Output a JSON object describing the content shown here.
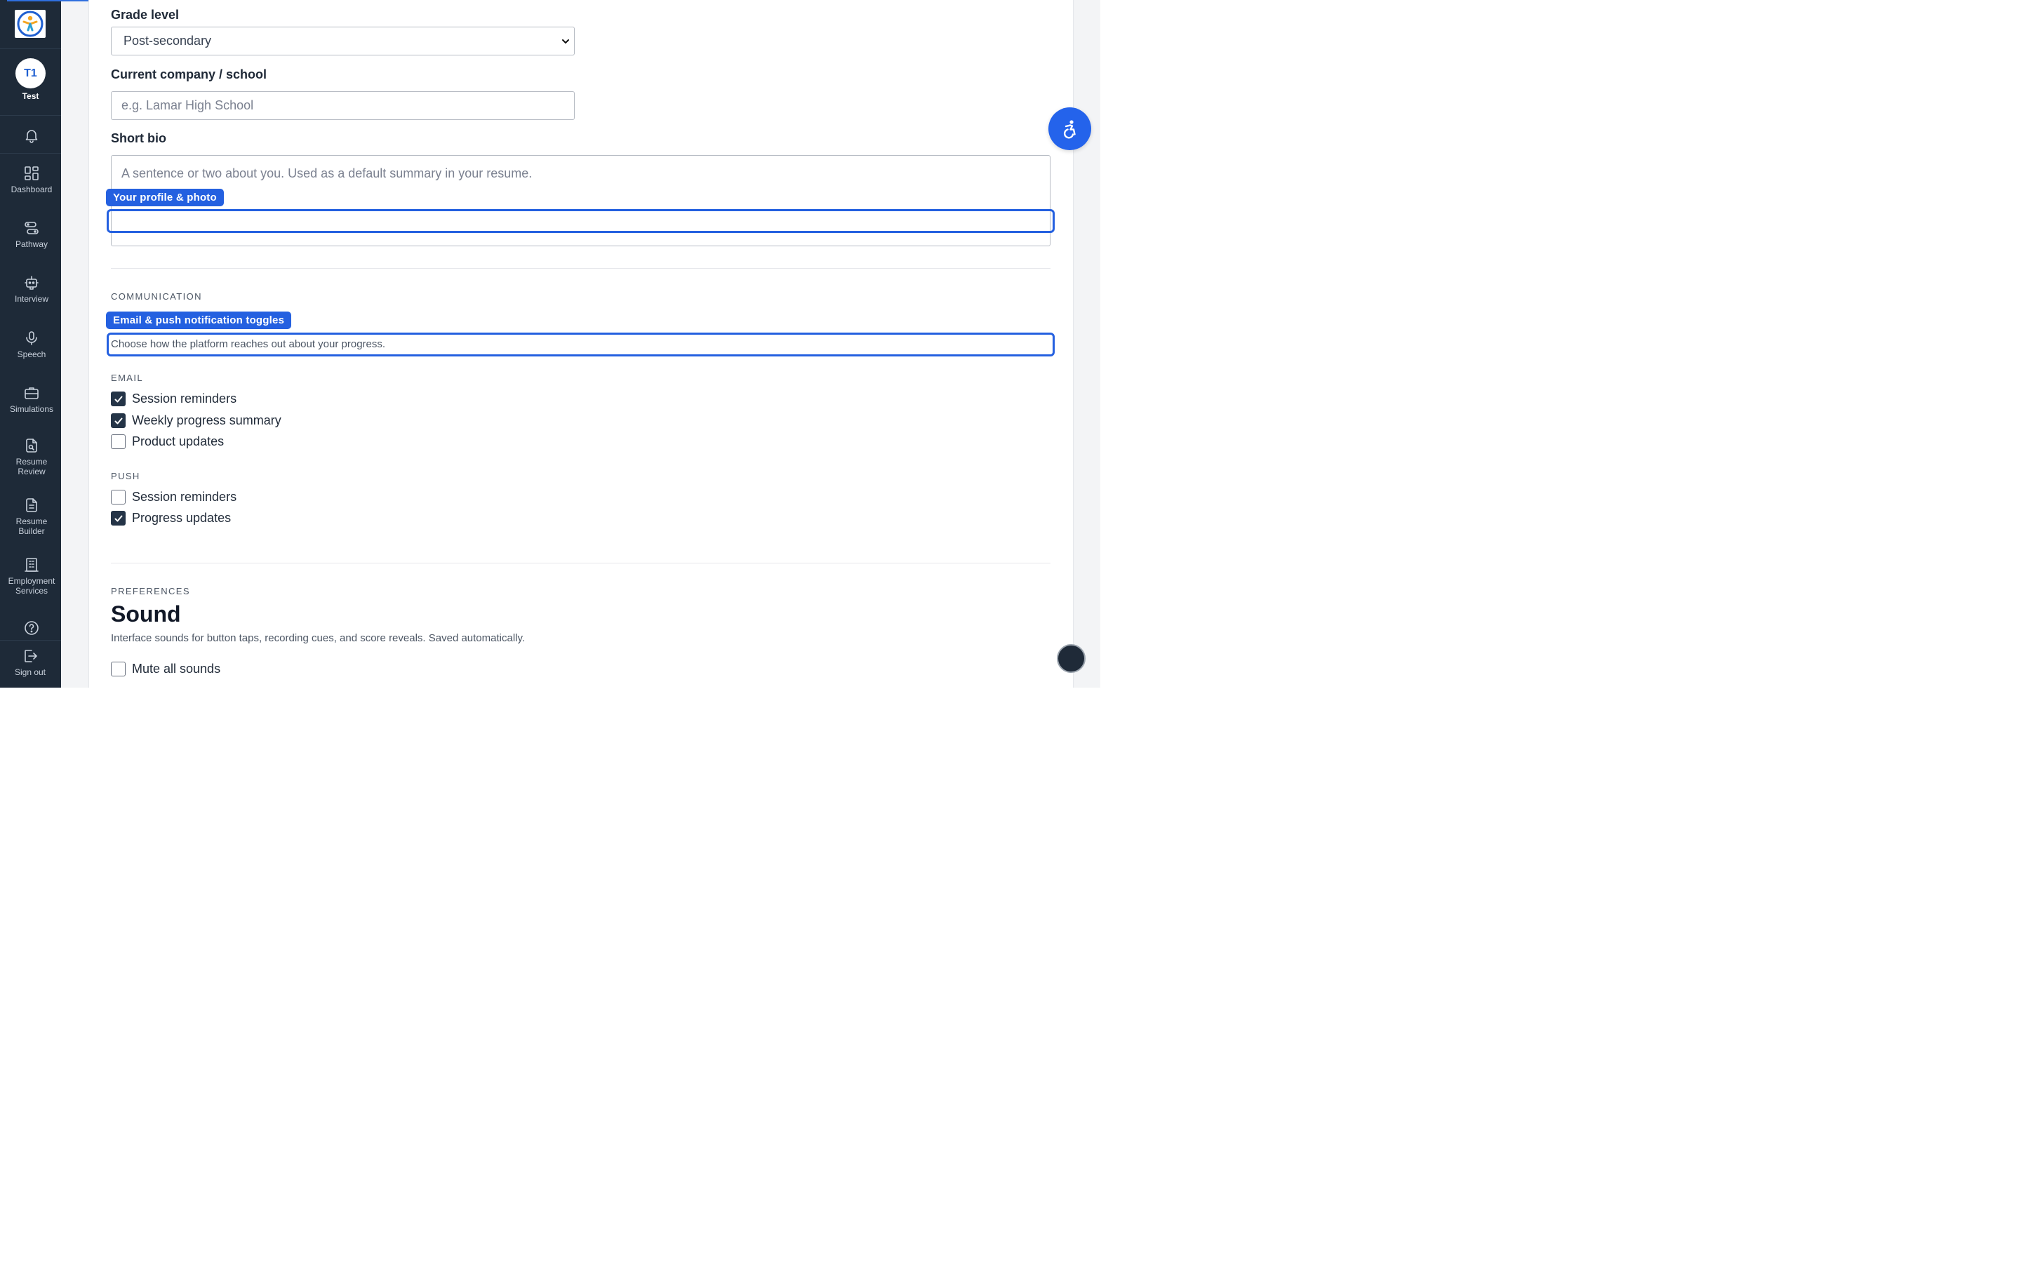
{
  "sidebar": {
    "user": {
      "initials": "T1",
      "name": "Test"
    },
    "items": [
      {
        "label": "Dashboard",
        "icon": "dashboard-icon"
      },
      {
        "label": "Pathway",
        "icon": "pathway-icon"
      },
      {
        "label": "Interview",
        "icon": "robot-icon"
      },
      {
        "label": "Speech",
        "icon": "microphone-icon"
      },
      {
        "label": "Simulations",
        "icon": "briefcase-icon"
      },
      {
        "label_line1": "Resume",
        "label_line2": "Review",
        "icon": "document-search-icon"
      },
      {
        "label_line1": "Resume",
        "label_line2": "Builder",
        "icon": "document-icon"
      },
      {
        "label_line1": "Employment",
        "label_line2": "Services",
        "icon": "building-icon"
      }
    ],
    "sign_out": "Sign out"
  },
  "form": {
    "grade_level": {
      "label": "Grade level",
      "value": "Post-secondary"
    },
    "company": {
      "label": "Current company / school",
      "placeholder": "e.g. Lamar High School"
    },
    "bio": {
      "label": "Short bio",
      "placeholder": "A sentence or two about you. Used as a default summary in your resume."
    }
  },
  "highlights": {
    "profile": "Your profile & photo",
    "notifications": "Email & push notification toggles"
  },
  "communication": {
    "eyebrow": "COMMUNICATION",
    "description": "Choose how the platform reaches out about your progress.",
    "email": {
      "eyebrow": "EMAIL",
      "options": [
        {
          "label": "Session reminders",
          "checked": true
        },
        {
          "label": "Weekly progress summary",
          "checked": true
        },
        {
          "label": "Product updates",
          "checked": false
        }
      ]
    },
    "push": {
      "eyebrow": "PUSH",
      "options": [
        {
          "label": "Session reminders",
          "checked": false
        },
        {
          "label": "Progress updates",
          "checked": true
        }
      ]
    }
  },
  "preferences": {
    "eyebrow": "PREFERENCES",
    "title": "Sound",
    "description": "Interface sounds for button taps, recording cues, and score reveals. Saved automatically.",
    "mute": {
      "label": "Mute all sounds",
      "checked": false
    }
  },
  "colors": {
    "accent": "#2460e0",
    "sidebar_bg": "#1e2a38",
    "checkbox_checked": "#243447"
  }
}
